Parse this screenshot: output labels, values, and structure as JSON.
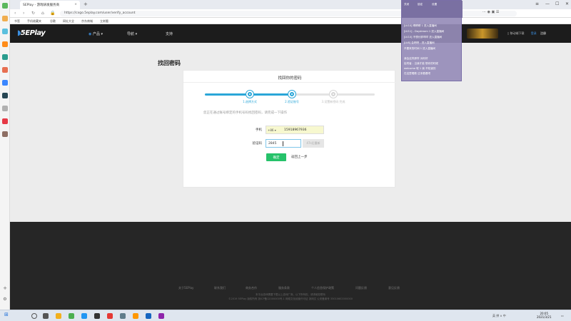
{
  "browser": {
    "tab_title": "SEPlay - 游戏研发服务商",
    "new_tab": "+",
    "url": "https://cxgo.5eplay.com/user/verify_account",
    "bookmarks": [
      "书签",
      "手机收藏夹",
      "谷歌",
      "网址大全",
      "京东商城",
      "立刻看"
    ]
  },
  "header": {
    "logo_text": "5EPlay",
    "nav": [
      "产品",
      "导航",
      "支持"
    ],
    "phone_download": "移动端下载",
    "login": "登录",
    "register": "注册"
  },
  "page": {
    "title": "找回密码",
    "card_title": "找回你的密码",
    "steps": [
      "1.选择方式",
      "2.验证账号",
      "3.设置新密码 完成"
    ],
    "current_step": 2,
    "hint": "您正在通过账号绑定的手机号码找回密码，请完成一下操作",
    "phone_label": "手机",
    "country_code": "+86 ▾",
    "phone_number": "15918967936",
    "code_label": "验证码",
    "code_value": "2845",
    "resend_label": "47s后重新",
    "next_button": "确定",
    "back_link": "返回上一步"
  },
  "footer": {
    "links": [
      "关于5EPlay",
      "联系我们",
      "商务合作",
      "服务条款",
      "个人信息保护政策",
      "问题反馈",
      "意见反馈"
    ],
    "line1": "本平台游戏需要下载以上游戏厂商，以下所有权，请求维权联系",
    "line2": "©2019 5EPlay 版权所有 浙ICP备12000000号-1 网络文化经营许可证 浙网文 公安备案号 33010602000000"
  },
  "overlay": {
    "header_items": [
      "关闭",
      "锁定",
      "设置"
    ],
    "lines": [
      "[LV10] 晴晴晴 1 进入直播间",
      "[LV11] - Daydream 1 进入直播间",
      "[LV10] 不想长胖咩咩 进入直播间",
      "[LV6] 会吧吧 - 进入直播间",
      "不要来的时间 1 进入直播间",
      "我会这样那样 对你好",
      "拾荒者 - 当我才能 想你的时候",
      "welcome 呢 1 我 不知道的",
      "在这里唱歌 过来看看吧"
    ]
  },
  "taskbar": {
    "time": "20:05",
    "date": "2021/3/21",
    "tray_text": "英 拼 ∧ 中"
  }
}
